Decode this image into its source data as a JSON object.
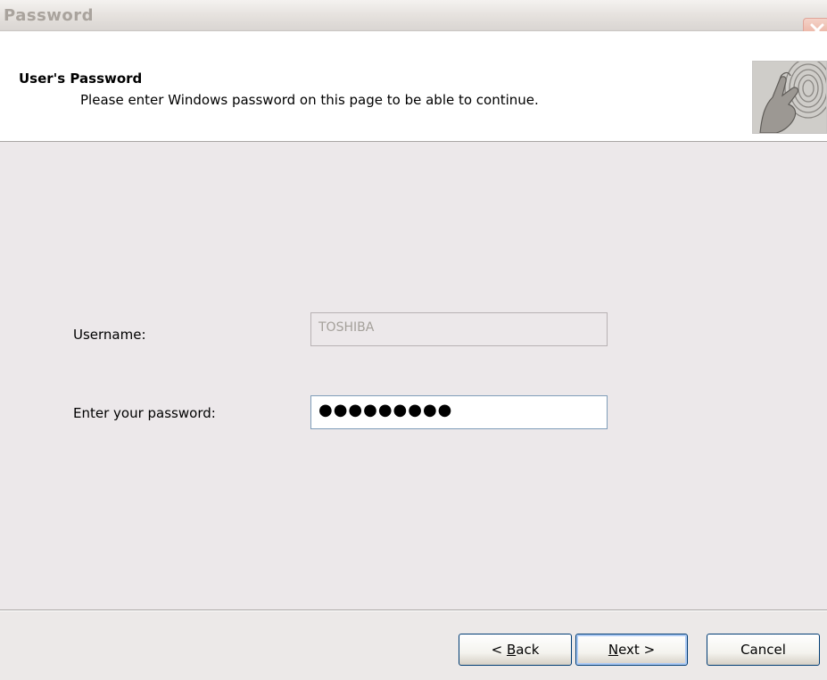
{
  "window": {
    "title": "Password"
  },
  "header": {
    "heading": "User's Password",
    "subheading": "Please enter Windows password on this page to be able to continue."
  },
  "form": {
    "username_label": "Username:",
    "username_value": "TOSHIBA",
    "password_label": "Enter your password:",
    "password_value": "●●●●●●●●●"
  },
  "buttons": {
    "back_prefix": "< ",
    "back_mnemonic": "B",
    "back_rest": "ack",
    "next_mnemonic": "N",
    "next_rest": "ext >",
    "cancel": "Cancel"
  },
  "icons": {
    "close": "close-icon",
    "header_image": "fingerprint-hand-image"
  },
  "colors": {
    "title_text": "#a9a39d",
    "close_button": "#e7a593",
    "body_background": "#ece8ea",
    "field_border": "#7f9db9",
    "button_border": "#003c74"
  }
}
